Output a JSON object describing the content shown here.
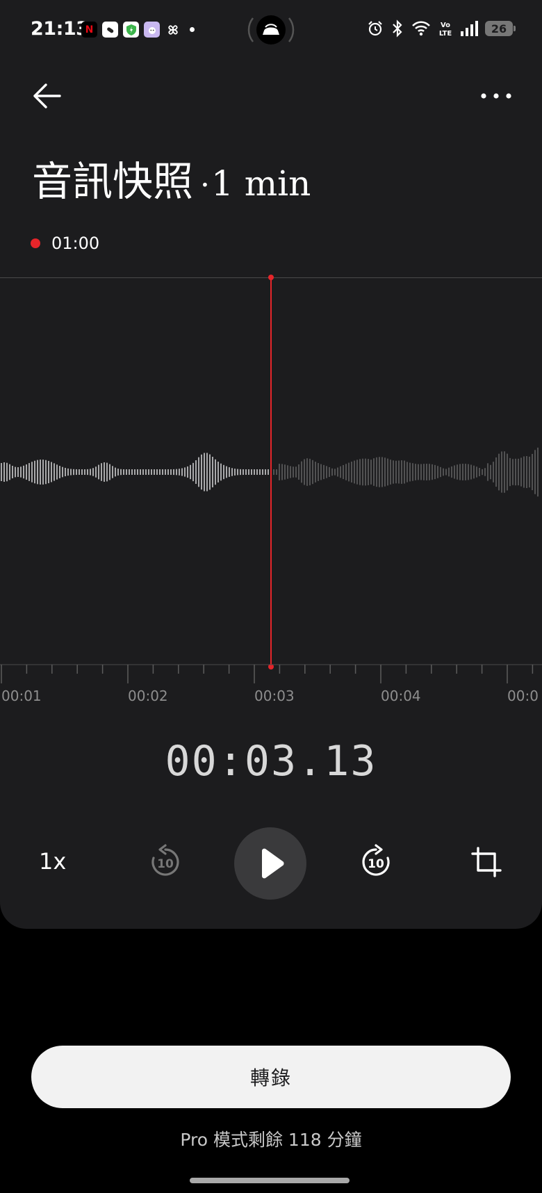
{
  "status_bar": {
    "time": "21:13",
    "battery": "26",
    "notification_icons": [
      "netflix-icon",
      "app-icon",
      "shield-icon",
      "face-app-icon",
      "fan-icon"
    ],
    "system_icons": [
      "alarm-icon",
      "bluetooth-icon",
      "wifi-icon",
      "volte-icon",
      "signal-icon",
      "battery-icon"
    ]
  },
  "header": {
    "title": "音訊快照",
    "separator": "·",
    "duration": "1 min",
    "recording_time": "01:00"
  },
  "timeline": {
    "ticks": [
      "00:01",
      "00:02",
      "00:03",
      "00:04",
      "00:0"
    ],
    "current_time": "00:03.13",
    "played_fraction": 0.5
  },
  "controls": {
    "speed": "1x",
    "skip_back_seconds": "10",
    "skip_forward_seconds": "10"
  },
  "footer": {
    "transcribe_label": "轉錄",
    "pro_info": "Pro 模式剩餘 118 分鐘"
  },
  "colors": {
    "accent_red": "#e5252a",
    "card_background": "#1c1c1e",
    "button_light": "#f2f2f2"
  }
}
